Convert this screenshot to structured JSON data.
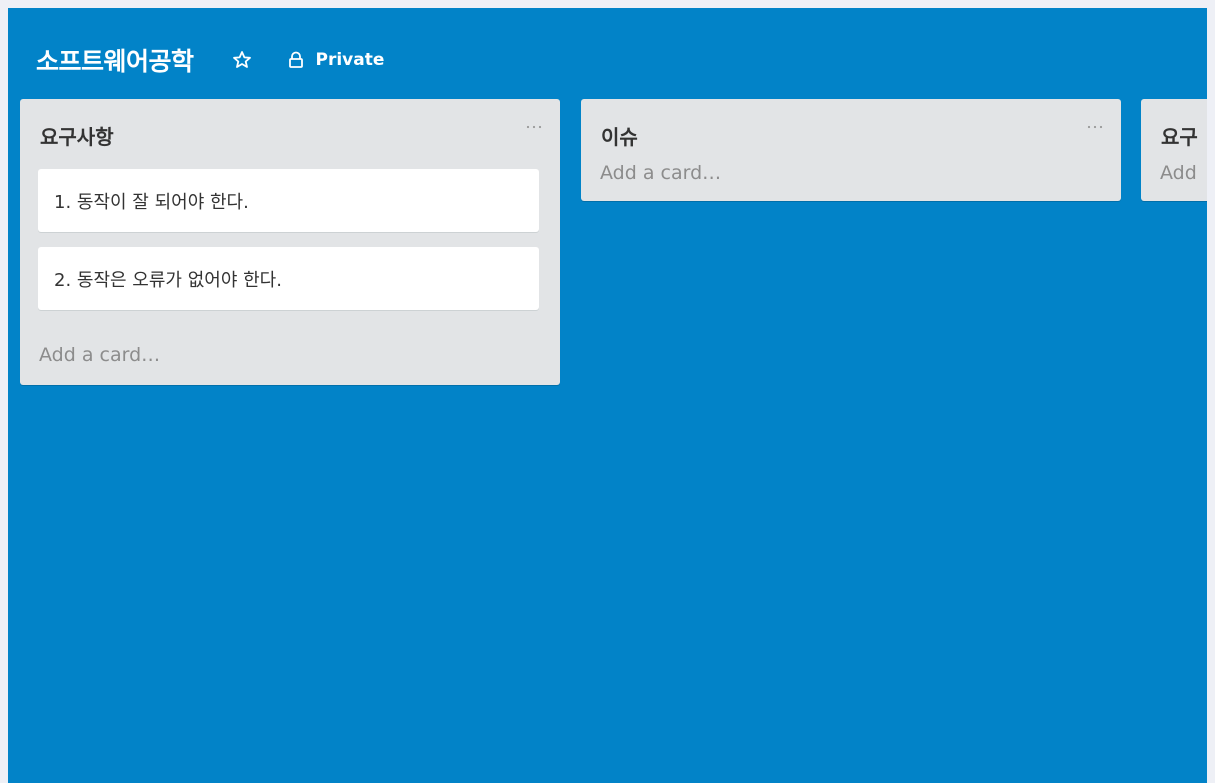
{
  "board": {
    "title": "소프트웨어공학",
    "visibility_label": "Private",
    "background_color": "#0283c8"
  },
  "icons": {
    "star": "star-outline-icon",
    "lock": "lock-icon",
    "menu": "ellipsis-icon"
  },
  "lists": [
    {
      "title": "요구사항",
      "cards": [
        "1. 동작이 잘 되어야 한다.",
        "2. 동작은 오류가 없어야 한다."
      ],
      "add_card_label": "Add a card…"
    },
    {
      "title": "이슈",
      "cards": [],
      "add_card_label": "Add a card…"
    },
    {
      "title": "요구",
      "cards": [],
      "add_card_label": "Add"
    }
  ]
}
